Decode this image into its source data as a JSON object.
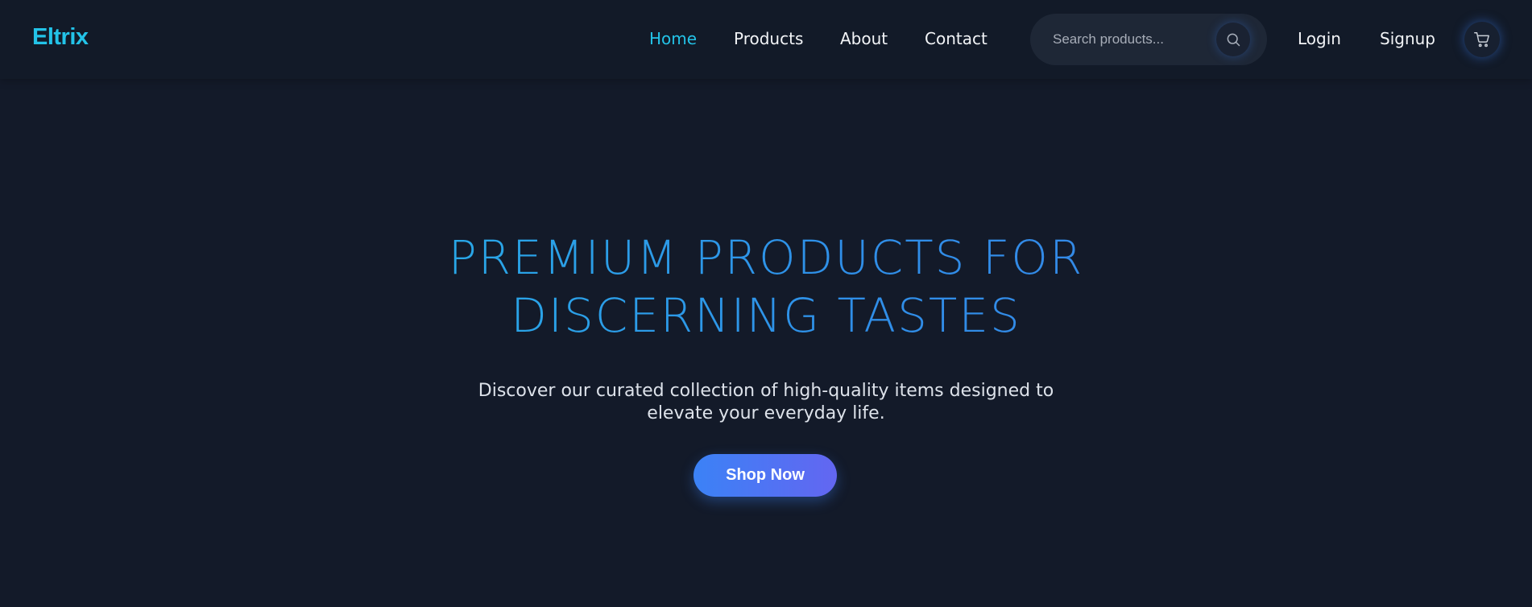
{
  "brand": {
    "logo_text": "Eltrix",
    "accent_color": "#23c3e8"
  },
  "nav": {
    "links": [
      {
        "label": "Home",
        "active": true
      },
      {
        "label": "Products",
        "active": false
      },
      {
        "label": "About",
        "active": false
      },
      {
        "label": "Contact",
        "active": false
      }
    ],
    "search": {
      "placeholder": "Search products...",
      "value": "",
      "icon": "search-icon"
    },
    "login_label": "Login",
    "signup_label": "Signup",
    "cart_icon": "cart-icon"
  },
  "hero": {
    "title_line_1": "PREMIUM PRODUCTS FOR",
    "title_line_2": "DISCERNING TASTES",
    "subtitle": "Discover our curated collection of high-quality items designed to elevate your everyday life.",
    "cta_label": "Shop Now"
  },
  "colors": {
    "background": "#131a29",
    "nav_text": "#f2f4f7",
    "button_gradient_start": "#3b82f6",
    "button_gradient_end": "#6366f1"
  }
}
